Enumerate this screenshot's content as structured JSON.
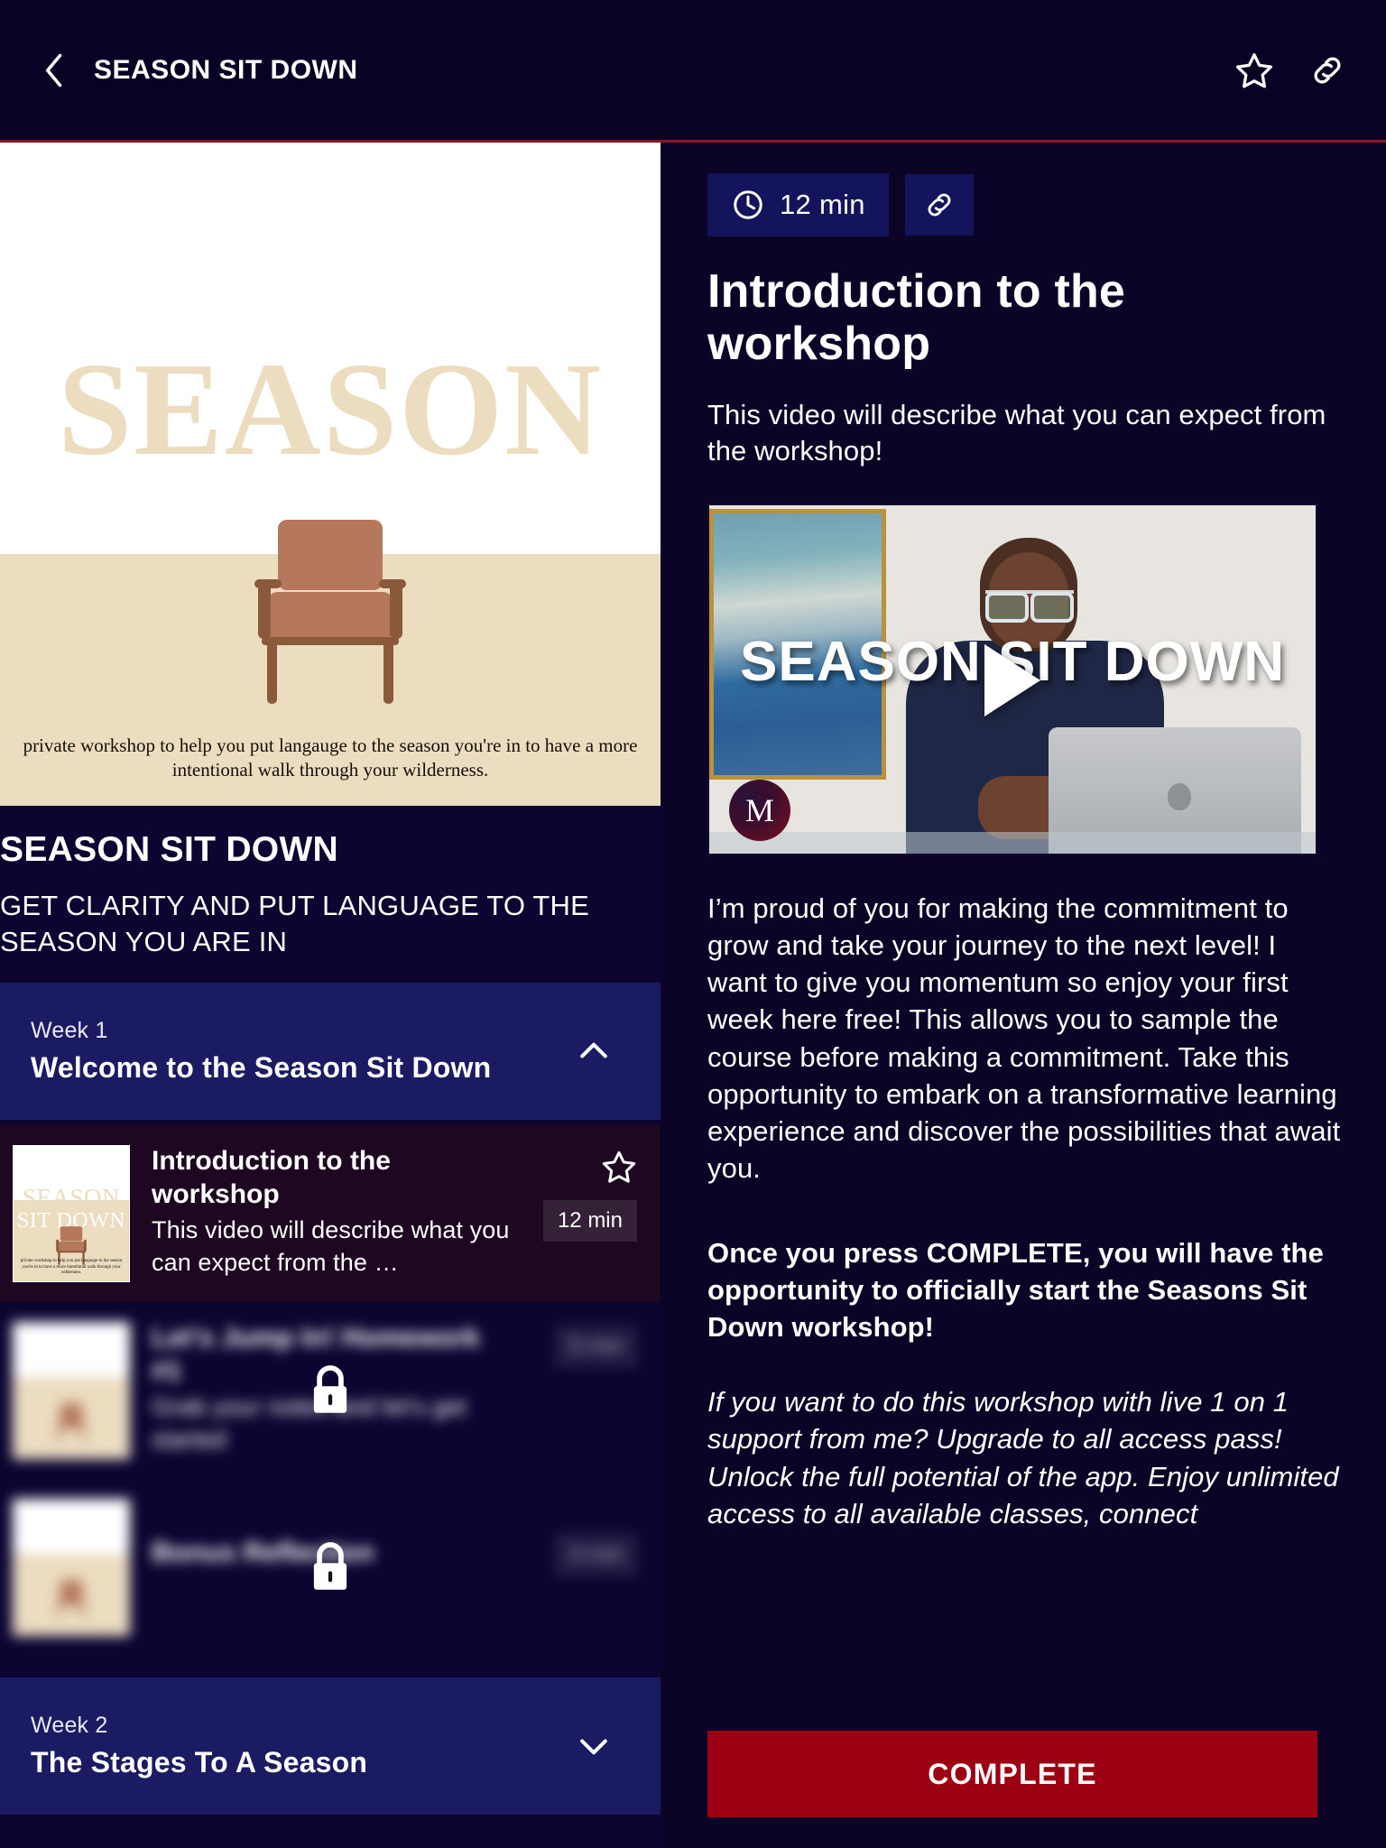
{
  "colors": {
    "header_bg": "#0a0224",
    "page_bg": "#0b0426",
    "left_panel_bg": "#0c0531",
    "week_header_bg": "#1a1b63",
    "active_lesson_bg": "#1d0721",
    "accent_rule": "#8c1420",
    "complete_button": "#9b0013",
    "pill_bg": "#14145c",
    "cover_cream": "#ecdcc0"
  },
  "header": {
    "back_icon": "chevron-left-icon",
    "title": "SEASON SIT DOWN",
    "favorite_icon": "star-outline-icon",
    "share_icon": "link-icon"
  },
  "cover": {
    "word_top": "SEASON",
    "word_bottom": "SIT DOWN",
    "caption": "private workshop to help you put langauge to the season you're in to have a more intentional walk through your wilderness."
  },
  "course": {
    "title": "SEASON SIT DOWN",
    "subtitle": "GET CLARITY AND PUT LANGUAGE TO THE SEASON YOU ARE IN"
  },
  "sections": [
    {
      "kicker": "Week 1",
      "name": "Welcome to the Season Sit Down",
      "expanded": true,
      "chevron": "chevron-up-icon"
    },
    {
      "kicker": "Week 2",
      "name": "The Stages To A Season",
      "expanded": false,
      "chevron": "chevron-down-icon"
    }
  ],
  "lessons": [
    {
      "title": "Introduction to the workshop",
      "desc": "This video will describe what you can expect from the …",
      "duration": "12 min",
      "locked": false,
      "favorite_icon": "star-outline-icon"
    },
    {
      "title": "Let's Jump In! Homework #1",
      "desc": "Grab your notes and let's get started",
      "duration": "5 min",
      "locked": true,
      "lock_icon": "lock-icon"
    },
    {
      "title": "Bonus Reflection",
      "desc": "",
      "duration": "3 min",
      "locked": true,
      "lock_icon": "lock-icon"
    }
  ],
  "detail": {
    "duration_icon": "clock-icon",
    "duration": "12 min",
    "share_icon": "link-icon",
    "title": "Introduction to the workshop",
    "description": "This video will describe what you can expect from the workshop!",
    "video": {
      "overlay_text": "SEASON SIT DOWN",
      "play_icon": "play-icon",
      "logo_letter": "M"
    },
    "paragraph_1": "I’m proud of you for making the commitment to grow and take your journey to the next level! I want to give you momentum so enjoy your first week here free! This allows you to sample the course before making a commitment. Take this opportunity to embark on a transformative learning experience and discover the possibilities that await you.",
    "paragraph_2_bold": "Once you press COMPLETE, you will have the opportunity to officially start the Seasons Sit Down workshop!",
    "paragraph_3_italic": "If you want to do this workshop with live 1 on 1 support from me? Upgrade to all access pass! Unlock the full potential of the app. Enjoy unlimited access to all available classes, connect",
    "complete_label": "COMPLETE"
  }
}
